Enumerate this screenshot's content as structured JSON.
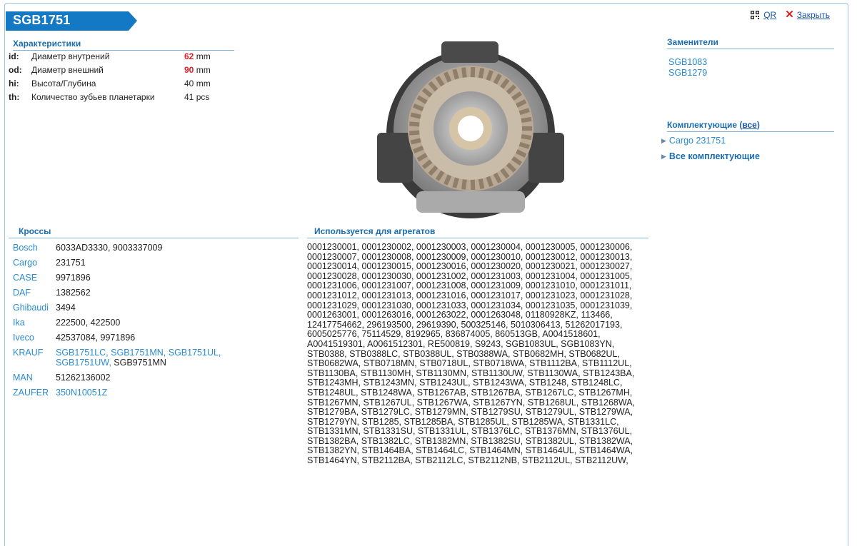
{
  "title": "SGB1751",
  "toplinks": {
    "qr_label": "QR",
    "close_label": "Закрыть"
  },
  "characteristics": {
    "heading": "Характеристики",
    "rows": [
      {
        "key": "id:",
        "name": "Диаметр внутрений",
        "value": "62",
        "unit": "mm",
        "highlight": true
      },
      {
        "key": "od:",
        "name": "Диаметр внешний",
        "value": "90",
        "unit": "mm",
        "highlight": true
      },
      {
        "key": "hi:",
        "name": "Высота/Глубина",
        "value": "40",
        "unit": "mm",
        "highlight": false
      },
      {
        "key": "th:",
        "name": "Количество зубьев планетарки",
        "value": "41",
        "unit": "pcs",
        "highlight": false
      }
    ]
  },
  "substitutes": {
    "heading": "Заменители",
    "items": [
      "SGB1083",
      "SGB1279"
    ]
  },
  "components": {
    "heading": "Комплектующие",
    "all_label": "все",
    "items": [
      "Cargo 231751"
    ],
    "all_components_label": "Все комплектующие"
  },
  "crosses": {
    "heading": "Кроссы",
    "rows": [
      {
        "brand": "Bosch",
        "links": [],
        "text": "6033AD3330, 9003337009"
      },
      {
        "brand": "Cargo",
        "links": [],
        "text": "231751"
      },
      {
        "brand": "CASE",
        "links": [],
        "text": "9971896"
      },
      {
        "brand": "DAF",
        "links": [],
        "text": "1382562"
      },
      {
        "brand": "Ghibaudi",
        "links": [],
        "text": "3494"
      },
      {
        "brand": "Ika",
        "links": [],
        "text": "222500, 422500"
      },
      {
        "brand": "Iveco",
        "links": [],
        "text": "42537084, 9971896"
      },
      {
        "brand": "KRAUF",
        "links": [
          "SGB1751LC, ",
          "SGB1751MN, ",
          "SGB1751UL,",
          "SGB1751UW, "
        ],
        "text": "SGB9751MN"
      },
      {
        "brand": "MAN",
        "links": [],
        "text": "51262136002"
      },
      {
        "brand": "ZAUFER",
        "links": [
          "350N10051Z"
        ],
        "text": ""
      }
    ]
  },
  "aggregates": {
    "heading": "Используется для агрегатов",
    "text": "0001230001, 0001230002, 0001230003, 0001230004, 0001230005, 0001230006, 0001230007, 0001230008, 0001230009, 0001230010, 0001230012, 0001230013, 0001230014, 0001230015, 0001230016, 0001230020, 0001230021, 0001230027, 0001230028, 0001230030, 0001231002, 0001231003, 0001231004, 0001231005, 0001231006, 0001231007, 0001231008, 0001231009, 0001231010, 0001231011, 0001231012, 0001231013, 0001231016, 0001231017, 0001231023, 0001231028, 0001231029, 0001231030, 0001231033, 0001231034, 0001231035, 0001231039, 0001263001, 0001263016, 0001263022, 0001263048, 01180928KZ, 113466, 12417754662, 296193500, 29619390, 500325146, 5010306413, 51262017193, 6005025776, 75114529, 8192965, 836874005, 860513GB, A0041518601, A0041519301, A0061512301, RE500819, S9243, SGB1083UL, SGB1083YN, STB0388, STB0388LC, STB0388UL, STB0388WA, STB0682MH, STB0682UL, STB0682WA, STB0718MN, STB0718UL, STB0718WA, STB1112BA, STB1112UL, STB1130BA, STB1130MH, STB1130MN, STB1130UW, STB1130WA, STB1243BA, STB1243MH, STB1243MN, STB1243UL, STB1243WA, STB1248, STB1248LC, STB1248UL, STB1248WA, STB1267AB, STB1267BA, STB1267LC, STB1267MH, STB1267MN, STB1267UL, STB1267WA, STB1267YN, STB1268UL, STB1268WA, STB1279BA, STB1279LC, STB1279MN, STB1279SU, STB1279UL, STB1279WA, STB1279YN, STB1285, STB1285BA, STB1285UL, STB1285WA, STB1331LC, STB1331MN, STB1331SU, STB1331UL, STB1376LC, STB1376MN, STB1376UL, STB1382BA, STB1382LC, STB1382MN, STB1382SU, STB1382UL, STB1382WA, STB1382YN, STB1464BA, STB1464LC, STB1464MN, STB1464UL, STB1464WA, STB1464YN, STB2112BA, STB2112LC, STB2112NB, STB2112UL, STB2112UW,"
  }
}
